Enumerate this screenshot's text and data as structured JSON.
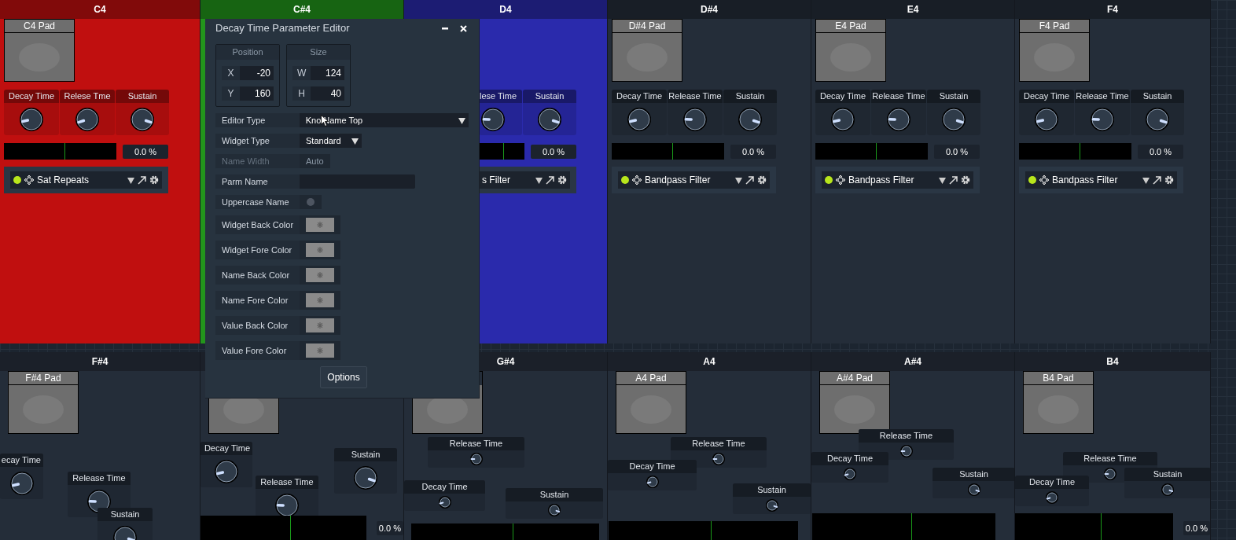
{
  "top_panels": [
    {
      "note": "C4",
      "color": "#c00f0f",
      "pad": "C4 Pad",
      "knobs": [
        {
          "name": "Decay Time",
          "level": 0.12
        },
        {
          "name": "Relese Tme",
          "level": 0.1
        },
        {
          "name": "Sustain",
          "level": 0.9
        }
      ],
      "reading": "0.0 %",
      "slot": {
        "name": "Sat Repeats",
        "led_on": true
      }
    },
    {
      "note": "C#4",
      "color": "#23951c"
    },
    {
      "note": "D4",
      "color": "#2a2aac",
      "covered": true,
      "knobs": [
        {
          "name": "lese Time",
          "level": 0.17
        },
        {
          "name": "Sustain",
          "level": 0.9
        }
      ],
      "reading": "0.0 %",
      "slot": {
        "name": "s Filter"
      }
    },
    {
      "note": "D#4",
      "color": "#242d39",
      "pad": "D#4 Pad",
      "knobs": [
        {
          "name": "Decay Time",
          "level": 0.12
        },
        {
          "name": "Release Time",
          "level": 0.17
        },
        {
          "name": "Sustain",
          "level": 0.9
        }
      ],
      "reading": "0.0 %",
      "slot": {
        "name": "Bandpass Filter",
        "led_on": true
      }
    },
    {
      "note": "E4",
      "color": "#242d39",
      "pad": "E4 Pad",
      "knobs": [
        {
          "name": "Decay Time",
          "level": 0.12
        },
        {
          "name": "Release Time",
          "level": 0.17
        },
        {
          "name": "Sustain",
          "level": 0.9
        }
      ],
      "reading": "0.0 %",
      "slot": {
        "name": "Bandpass Filter",
        "led_on": true
      }
    },
    {
      "note": "F4",
      "color": "#242d39",
      "pad": "F4 Pad",
      "knobs": [
        {
          "name": "Decay Time",
          "level": 0.12
        },
        {
          "name": "Release Time",
          "level": 0.17
        },
        {
          "name": "Sustain",
          "level": 0.9
        }
      ],
      "reading": "0.0 %",
      "slot": {
        "name": "Bandpass Filter",
        "led_on": true
      }
    }
  ],
  "bottom_panels": [
    {
      "note": "F#4",
      "pad": "F#4 Pad",
      "knobs": [
        {
          "name": "ecay Time",
          "kind": "large",
          "level": 0.12
        },
        {
          "name": "Release Time",
          "kind": "large",
          "level": 0.17
        },
        {
          "name": "Sustain",
          "kind": "large",
          "level": 0.9
        }
      ]
    },
    {
      "knobs": [
        {
          "name": "Decay Time",
          "kind": "large",
          "level": 0.12
        },
        {
          "name": "Release Time",
          "kind": "large",
          "level": 0.17
        },
        {
          "name": "Sustain",
          "kind": "large",
          "level": 0.9
        }
      ],
      "reading": "0.0 %"
    },
    {
      "note": "G#4",
      "knobs": [
        {
          "name": "Release Time",
          "kind": "small",
          "level": 0.17
        },
        {
          "name": "Decay Time",
          "kind": "small",
          "level": 0.12
        },
        {
          "name": "Sustain",
          "kind": "small",
          "level": 0.9
        }
      ]
    },
    {
      "note": "A4",
      "pad": "A4 Pad",
      "knobs": [
        {
          "name": "Release Time",
          "kind": "small",
          "level": 0.17
        },
        {
          "name": "Decay Time",
          "kind": "small",
          "level": 0.12
        },
        {
          "name": "Sustain",
          "kind": "small",
          "level": 0.9
        }
      ]
    },
    {
      "note": "A#4",
      "pad": "A#4 Pad",
      "knobs": [
        {
          "name": "Release Time",
          "kind": "small",
          "level": 0.17
        },
        {
          "name": "Decay Time",
          "kind": "small",
          "level": 0.12
        },
        {
          "name": "Sustain",
          "kind": "small",
          "level": 0.9
        }
      ]
    },
    {
      "note": "B4",
      "pad": "B4 Pad",
      "knobs": [
        {
          "name": "Release Time",
          "kind": "small",
          "level": 0.17
        },
        {
          "name": "Decay Time",
          "kind": "small",
          "level": 0.12
        },
        {
          "name": "Sustain",
          "kind": "small",
          "level": 0.9
        }
      ],
      "reading": "0.0 %"
    }
  ],
  "dialog": {
    "title": "Decay Time Parameter Editor",
    "position": {
      "title": "Position",
      "fields": [
        {
          "label": "X",
          "value": "-20"
        },
        {
          "label": "Y",
          "value": "160"
        }
      ]
    },
    "size": {
      "title": "Size",
      "fields": [
        {
          "label": "W",
          "value": "124"
        },
        {
          "label": "H",
          "value": "40"
        }
      ]
    },
    "rows": [
      {
        "kind": "dropdown",
        "label": "Editor Type",
        "value": "Kno Name Top",
        "disabled": false
      },
      {
        "kind": "dropdown",
        "label": "Widget Type",
        "value": "Standard",
        "disabled": false
      },
      {
        "kind": "text",
        "label": "Name Width",
        "value": "Auto",
        "disabled": true
      },
      {
        "kind": "input",
        "label": "Parm Name",
        "disabled": false
      },
      {
        "kind": "toggle",
        "label": "Uppercase Name",
        "on": false,
        "disabled": false
      },
      {
        "kind": "color",
        "label": "Widget Back Color",
        "disabled": false
      },
      {
        "kind": "color",
        "label": "Widget Fore Color",
        "disabled": false
      },
      {
        "kind": "color",
        "label": "Name Back Color",
        "disabled": false
      },
      {
        "kind": "color",
        "label": "Name Fore Color",
        "disabled": false
      },
      {
        "kind": "color",
        "label": "Value Back Color",
        "disabled": false
      },
      {
        "kind": "color",
        "label": "Value Fore Color",
        "disabled": false
      }
    ],
    "button": "Options"
  }
}
